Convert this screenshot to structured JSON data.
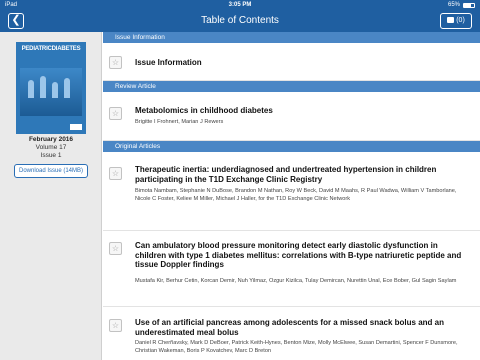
{
  "status_bar": {
    "carrier": "iPad",
    "time": "3:05 PM",
    "battery": "65%"
  },
  "nav": {
    "title": "Table of Contents",
    "back_glyph": "❮",
    "cart_label": "(0)"
  },
  "issue": {
    "cover_title": "PEDIATRICDIABETES",
    "date": "February 2016",
    "volume": "Volume 17",
    "issue": "Issue 1",
    "download_label": "Download Issue (14MB)"
  },
  "sections": {
    "issue_information": "Issue Information",
    "review_article": "Review Article",
    "original_articles": "Original Articles"
  },
  "articles": [
    {
      "title": "Issue Information",
      "authors": ""
    },
    {
      "title": "Metabolomics in childhood diabetes",
      "authors": "Brigitte I Frohnert, Marian J Rewers"
    },
    {
      "title": "Therapeutic inertia: underdiagnosed and undertreated hypertension in children participating in the T1D Exchange Clinic Registry",
      "authors": "Bimota Nambam, Stephanie N DuBose, Brandon M Nathan, Roy W Beck, David M Maahs, R Paul Wadwa, William V Tamborlane, Nicole C Foster, Keliee M Miller, Michael J Haller, for the T1D Exchange Clinic Network"
    },
    {
      "title": "Can ambulatory blood pressure monitoring detect early diastolic dysfunction in children with type 1 diabetes mellitus: correlations with B-type natriuretic peptide and tissue Doppler findings",
      "authors": "Mustafa Kir, Berhur Cetin, Korcan Demir, Nuh Yilmaz, Ozgur Kizilca, Tulay Demircan, Nurettin Unal, Ece Bober, Gul Sagin Saylam"
    },
    {
      "title": "Use of an artificial pancreas among adolescents for a missed snack bolus and an underestimated meal bolus",
      "authors": "Daniel R Cherñavsky, Mark D DeBoer, Patrick Keith-Hynes, Benton Mize, Molly McElwee, Susan Demartini, Spencer F Dunsmore, Christian Wakeman, Boris P Kovatchev, Marc D Breton"
    }
  ],
  "icons": {
    "star": "star-icon",
    "back": "chevron-left-icon",
    "cart": "cart-icon"
  },
  "colors": {
    "nav_blue": "#1f5fa1",
    "section_blue": "#4a86c5",
    "link_blue": "#2a6eb5"
  }
}
